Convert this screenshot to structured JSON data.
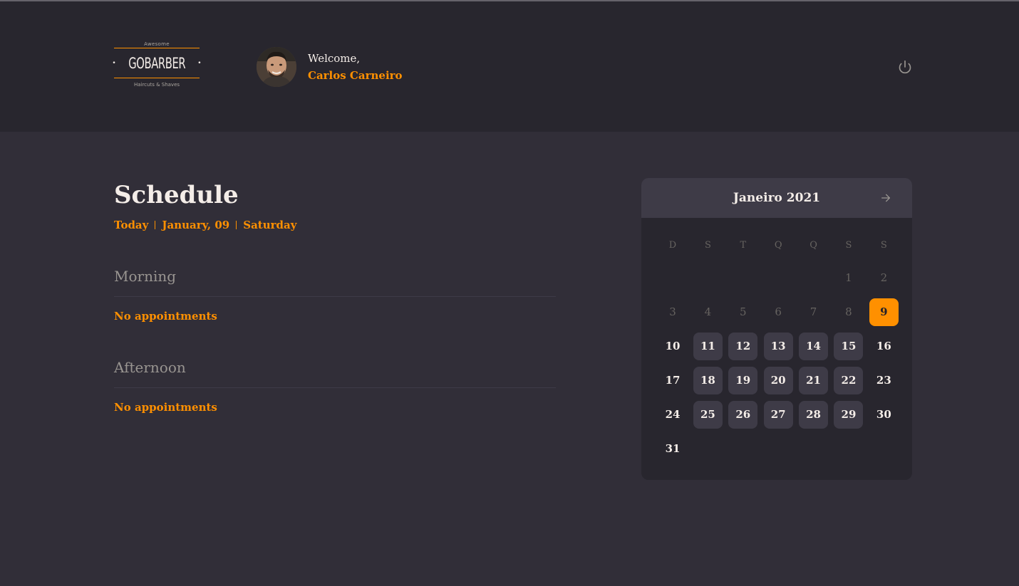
{
  "header": {
    "logo": {
      "top_text": "Awesome",
      "name": "GOBARBER",
      "bottom_text": "Haircuts & Shaves"
    },
    "welcome": "Welcome,",
    "user_name": "Carlos Carneiro",
    "logout_icon": "power-icon"
  },
  "schedule": {
    "title": "Schedule",
    "today_label": "Today",
    "date_label": "January, 09",
    "weekday_label": "Saturday",
    "morning": {
      "title": "Morning",
      "empty_text": "No appointments"
    },
    "afternoon": {
      "title": "Afternoon",
      "empty_text": "No appointments"
    }
  },
  "calendar": {
    "month_label": "Janeiro 2021",
    "next_icon": "arrow-right-icon",
    "weekdays": [
      "D",
      "S",
      "T",
      "Q",
      "Q",
      "S",
      "S"
    ],
    "weeks": [
      [
        null,
        null,
        null,
        null,
        null,
        1,
        2
      ],
      [
        3,
        4,
        5,
        6,
        7,
        8,
        9
      ],
      [
        10,
        11,
        12,
        13,
        14,
        15,
        16
      ],
      [
        17,
        18,
        19,
        20,
        21,
        22,
        23
      ],
      [
        24,
        25,
        26,
        27,
        28,
        29,
        30
      ],
      [
        31,
        null,
        null,
        null,
        null,
        null,
        null
      ]
    ],
    "selected_day": 9,
    "past_days": [
      1,
      2,
      3,
      4,
      5,
      6,
      7,
      8
    ],
    "available_days": [
      11,
      12,
      13,
      14,
      15,
      18,
      19,
      20,
      21,
      22,
      25,
      26,
      27,
      28,
      29
    ],
    "colors": {
      "accent": "#ff9000",
      "available_bg": "#3e3b47",
      "past_text": "#666360"
    }
  }
}
